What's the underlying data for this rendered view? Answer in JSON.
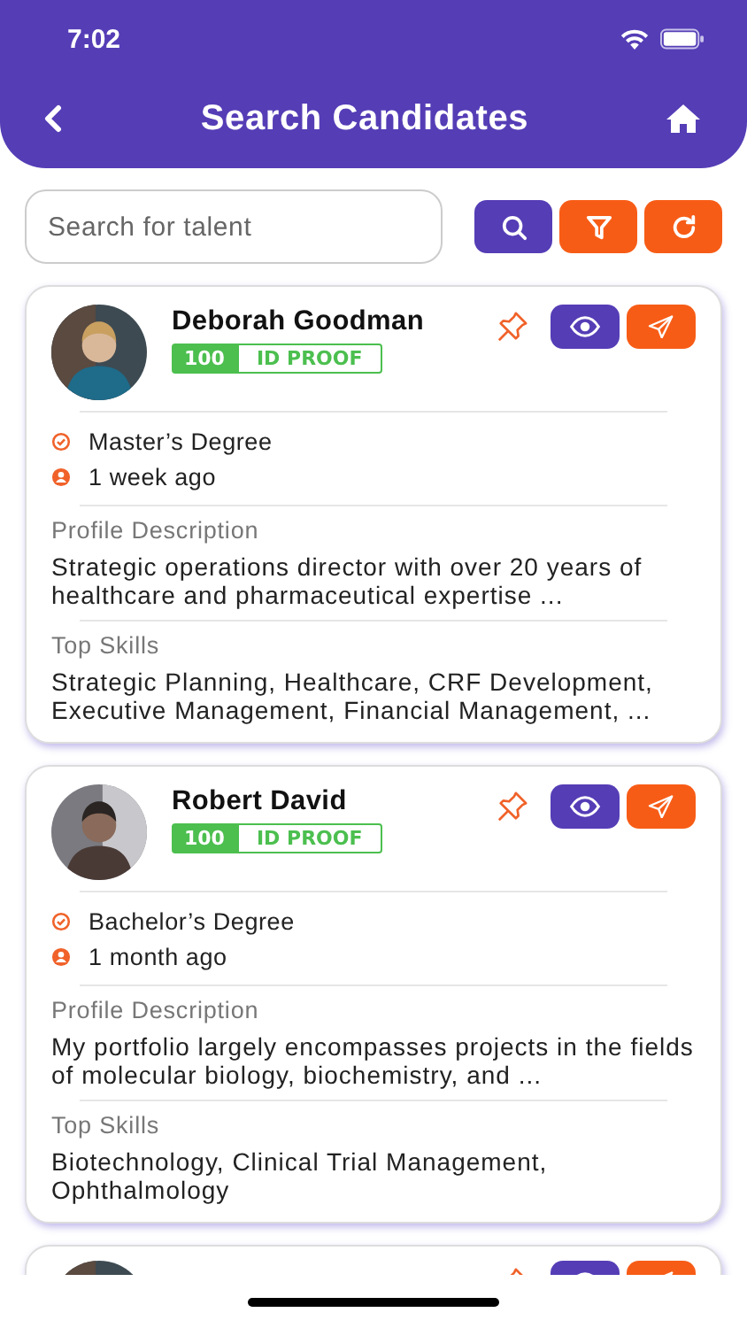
{
  "status_bar": {
    "time": "7:02"
  },
  "header": {
    "title": "Search Candidates"
  },
  "search": {
    "placeholder": "Search for talent"
  },
  "candidates": [
    {
      "kind": "full",
      "name": "Deborah Goodman",
      "score": "100",
      "verification": "ID PROOF",
      "degree": "Master’s Degree",
      "updated": "1 week ago",
      "description_label": "Profile Description",
      "description": "Strategic operations director with over 20 years of healthcare and pharmaceutical expertise ...",
      "skills_label": "Top Skills",
      "skills": "Strategic Planning, Healthcare, CRF Development, Executive Management, Financial Management, ..."
    },
    {
      "kind": "full",
      "name": "Robert David",
      "score": "100",
      "verification": "ID PROOF",
      "degree": "Bachelor’s Degree",
      "updated": "1 month ago",
      "description_label": "Profile Description",
      "description": "My portfolio largely encompasses projects in the fields of molecular biology, biochemistry, and ...",
      "skills_label": "Top Skills",
      "skills": "Biotechnology, Clinical Trial Management, Ophthalmology"
    },
    {
      "kind": "partial"
    }
  ]
}
